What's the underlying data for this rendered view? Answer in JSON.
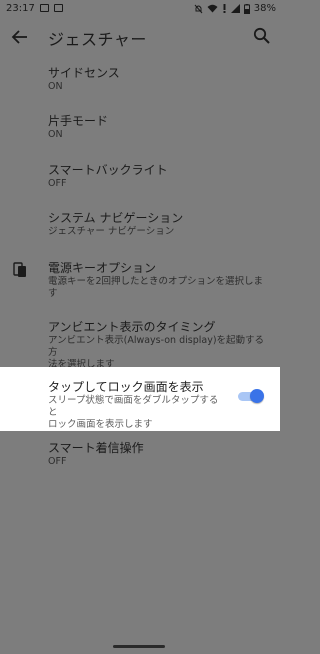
{
  "status_bar": {
    "time": "23:17",
    "battery": "38%"
  },
  "app_bar": {
    "title": "ジェスチャー"
  },
  "items": [
    {
      "title": "サイドセンス",
      "subtitle": "ON"
    },
    {
      "title": "片手モード",
      "subtitle": "ON"
    },
    {
      "title": "スマートバックライト",
      "subtitle": "OFF"
    },
    {
      "title": "システム ナビゲーション",
      "subtitle": "ジェスチャー ナビゲーション"
    },
    {
      "title": "電源キーオプション",
      "subtitle_lines": [
        "電源キーを2回押したときのオプションを選択しま",
        "す"
      ]
    },
    {
      "title": "アンビエント表示のタイミング",
      "subtitle_lines": [
        "アンビエント表示(Always-on display)を起動する方",
        "法を選択します"
      ]
    },
    {
      "title": "タップしてロック画面を表示",
      "subtitle_lines": [
        "スリープ状態で画面をダブルタップすると",
        "ロック画面を表示します"
      ],
      "toggle_on": true
    },
    {
      "title": "スマート着信操作",
      "subtitle": "OFF"
    }
  ],
  "colors": {
    "dim_background": "#7d7d7d",
    "toggle_accent": "#3a73e8"
  }
}
